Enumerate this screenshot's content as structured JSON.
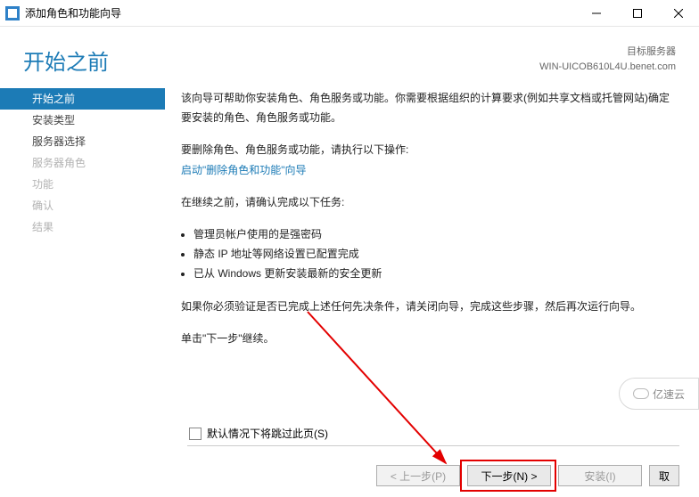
{
  "window": {
    "title": "添加角色和功能向导"
  },
  "header": {
    "title": "开始之前",
    "dest_label": "目标服务器",
    "dest_value": "WIN-UICOB610L4U.benet.com"
  },
  "sidebar": {
    "items": [
      {
        "label": "开始之前",
        "state": "selected"
      },
      {
        "label": "安装类型",
        "state": "normal"
      },
      {
        "label": "服务器选择",
        "state": "normal"
      },
      {
        "label": "服务器角色",
        "state": "disabled"
      },
      {
        "label": "功能",
        "state": "disabled"
      },
      {
        "label": "确认",
        "state": "disabled"
      },
      {
        "label": "结果",
        "state": "disabled"
      }
    ]
  },
  "content": {
    "intro": "该向导可帮助你安装角色、角色服务或功能。你需要根据组织的计算要求(例如共享文档或托管网站)确定要安装的角色、角色服务或功能。",
    "remove_label": "要删除角色、角色服务或功能，请执行以下操作:",
    "remove_link": "启动\"删除角色和功能\"向导",
    "before_continue": "在继续之前，请确认完成以下任务:",
    "bullets": [
      "管理员帐户使用的是强密码",
      "静态 IP 地址等网络设置已配置完成",
      "已从 Windows 更新安装最新的安全更新"
    ],
    "verify": "如果你必须验证是否已完成上述任何先决条件，请关闭向导，完成这些步骤，然后再次运行向导。",
    "next_hint": "单击\"下一步\"继续。",
    "skip_label": "默认情况下将跳过此页(S)"
  },
  "buttons": {
    "prev": "< 上一步(P)",
    "next": "下一步(N) >",
    "install": "安装(I)",
    "cancel": "取"
  },
  "watermark": "亿速云"
}
